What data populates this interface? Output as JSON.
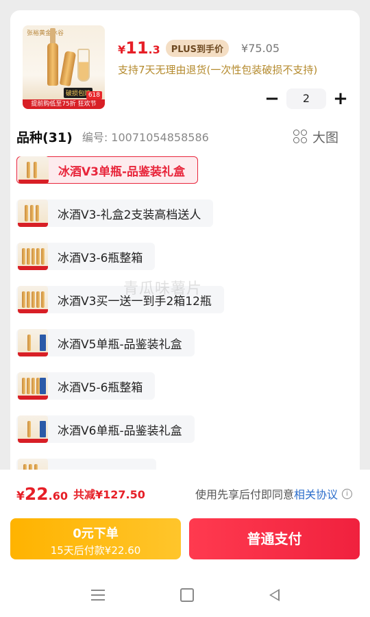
{
  "product": {
    "thumbnail_icon": "ice-wine-product-image",
    "thumb_logo": "张裕黄金冰谷",
    "thumb_promo": "提前购低至75折 狂欢节",
    "thumb_618": "618",
    "thumb_badge": "破损包赔",
    "price_symbol": "¥",
    "price_int": "11",
    "price_dec": ".3",
    "plus_tag": "PLUS到手价",
    "original_price": "¥75.05",
    "return_policy": "支持7天无理由退货(一次性包装破损不支持)"
  },
  "stepper": {
    "minus": "−",
    "quantity": "2",
    "plus": "+"
  },
  "variants_header": {
    "title": "品种(31)",
    "sku": "编号: 10071054858586",
    "view_label": "大图",
    "view_icon": "grid-icon"
  },
  "variants": [
    {
      "label": "冰酒V3单瓶-品鉴装礼盒",
      "selected": true
    },
    {
      "label": "冰酒V3-礼盒2支装高档送人",
      "selected": false
    },
    {
      "label": "冰酒V3-6瓶整箱",
      "selected": false
    },
    {
      "label": "冰酒V3买一送一到手2箱12瓶",
      "selected": false
    },
    {
      "label": "冰酒V5单瓶-品鉴装礼盒",
      "selected": false
    },
    {
      "label": "冰酒V5-6瓶整箱",
      "selected": false
    },
    {
      "label": "冰酒V6单瓶-品鉴装礼盒",
      "selected": false
    }
  ],
  "watermark": "青瓜味薯片",
  "footer": {
    "total_symbol": "¥",
    "total_int": "22",
    "total_dec": ".60",
    "saving": "共减¥127.50",
    "agree_text": "使用先享后付即同意",
    "agree_link": "相关协议",
    "info_icon": "i",
    "zero_button_line1": "0元下单",
    "zero_button_line2": "15天后付款¥22.60",
    "normal_button": "普通支付"
  },
  "navbar": {
    "icons": [
      "menu-icon",
      "home-icon",
      "back-icon"
    ]
  },
  "colors": {
    "accent_red": "#e61f27",
    "gold": "#ffb300",
    "link_blue": "#2c6ecb"
  }
}
